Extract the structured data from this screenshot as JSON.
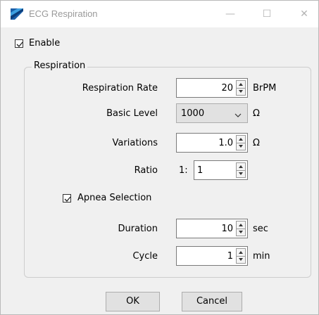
{
  "window": {
    "title": "ECG Respiration",
    "controls": {
      "minimize": "—",
      "maximize": "☐",
      "close": "✕"
    }
  },
  "enable": {
    "label": "Enable",
    "checked": true
  },
  "respiration_group": {
    "title": "Respiration",
    "respiration_rate": {
      "label": "Respiration Rate",
      "value": "20",
      "unit": "BrPM"
    },
    "basic_level": {
      "label": "Basic Level",
      "value": "1000",
      "unit": "Ω"
    },
    "variations": {
      "label": "Variations",
      "value": "1.0",
      "unit": "Ω"
    },
    "ratio": {
      "label": "Ratio",
      "prefix": "1:",
      "value": "1"
    },
    "apnea_selection": {
      "label": "Apnea Selection",
      "checked": true
    },
    "duration": {
      "label": "Duration",
      "value": "10",
      "unit": "sec"
    },
    "cycle": {
      "label": "Cycle",
      "value": "1",
      "unit": "min"
    }
  },
  "buttons": {
    "ok": "OK",
    "cancel": "Cancel"
  }
}
